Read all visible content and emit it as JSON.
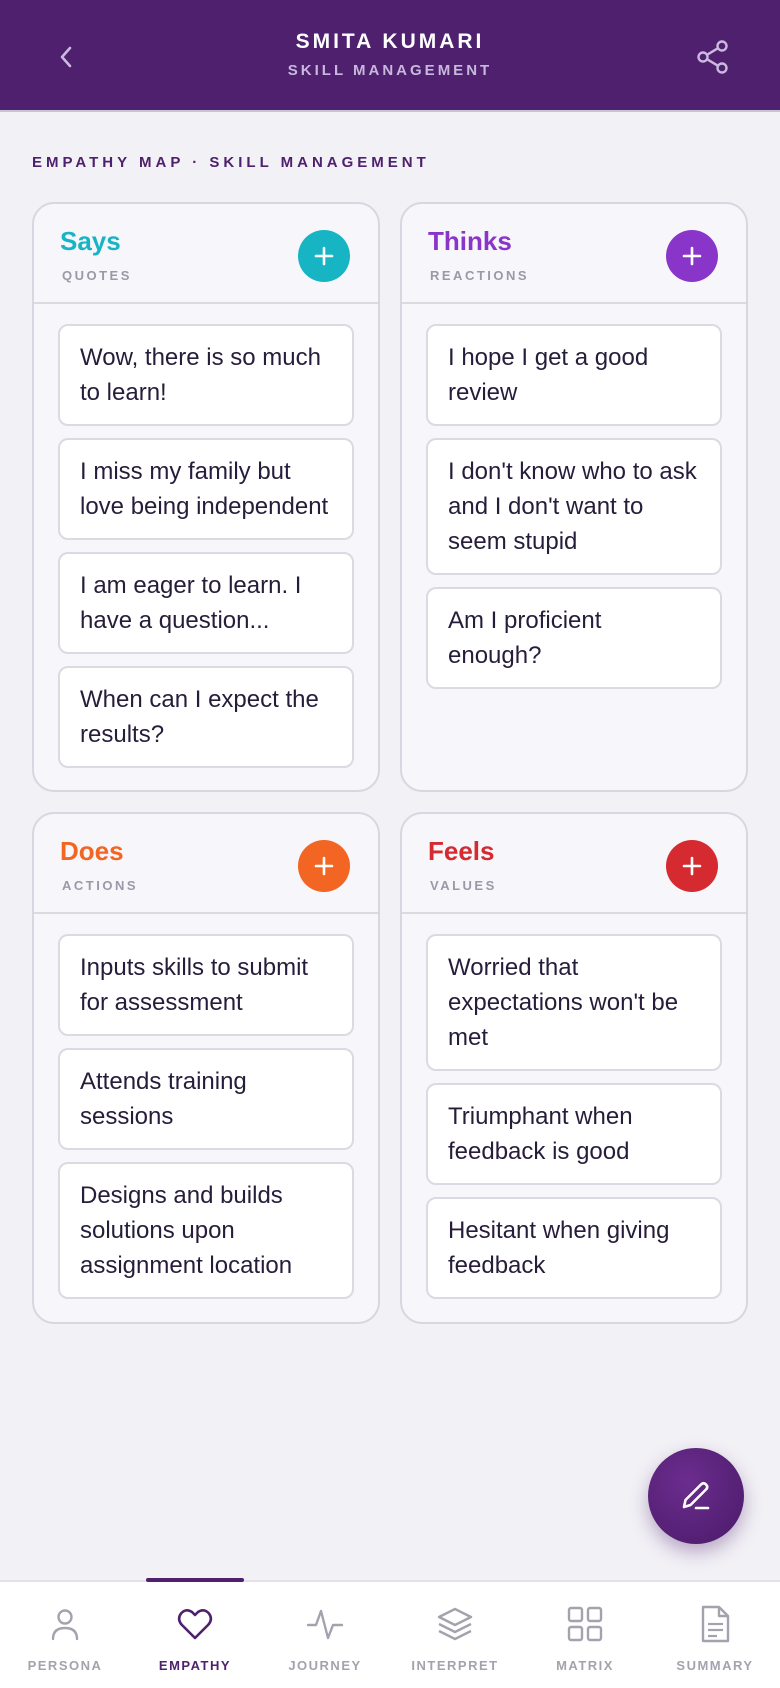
{
  "header": {
    "title": "SMITA KUMARI",
    "subtitle": "SKILL MANAGEMENT",
    "back_icon": "chevron-left-icon",
    "share_icon": "share-icon"
  },
  "section_label": "EMPATHY MAP · SKILL MANAGEMENT",
  "quadrants": {
    "says": {
      "title": "Says",
      "subtitle": "QUOTES",
      "color": "#17b5c4",
      "items": [
        "Wow, there is so much to learn!",
        "I miss my family but love being independent",
        "I am eager to learn. I have a question...",
        "When can I expect the results?"
      ]
    },
    "thinks": {
      "title": "Thinks",
      "subtitle": "REACTIONS",
      "color": "#8a35c9",
      "items": [
        "I hope I get a good review",
        "I don't know who to ask and I don't want to seem stupid",
        "Am I proficient enough?"
      ]
    },
    "does": {
      "title": "Does",
      "subtitle": "ACTIONS",
      "color": "#f26522",
      "items": [
        "Inputs skills to submit for assessment",
        "Attends training sessions",
        "Designs and builds solutions upon assignment location"
      ]
    },
    "feels": {
      "title": "Feels",
      "subtitle": "VALUES",
      "color": "#d42a30",
      "items": [
        "Worried that expectations won't be met",
        "Triumphant when feedback is good",
        "Hesitant when giving feedback"
      ]
    }
  },
  "fab_icon": "edit-pencil-icon",
  "nav": {
    "active": "EMPATHY",
    "items": [
      {
        "label": "PERSONA",
        "icon": "person-icon"
      },
      {
        "label": "EMPATHY",
        "icon": "heart-icon"
      },
      {
        "label": "JOURNEY",
        "icon": "activity-icon"
      },
      {
        "label": "INTERPRET",
        "icon": "layers-icon"
      },
      {
        "label": "MATRIX",
        "icon": "grid-icon"
      },
      {
        "label": "SUMMARY",
        "icon": "document-icon"
      }
    ]
  },
  "colors": {
    "brand": "#4e206d",
    "background": "#f2f1f6"
  }
}
